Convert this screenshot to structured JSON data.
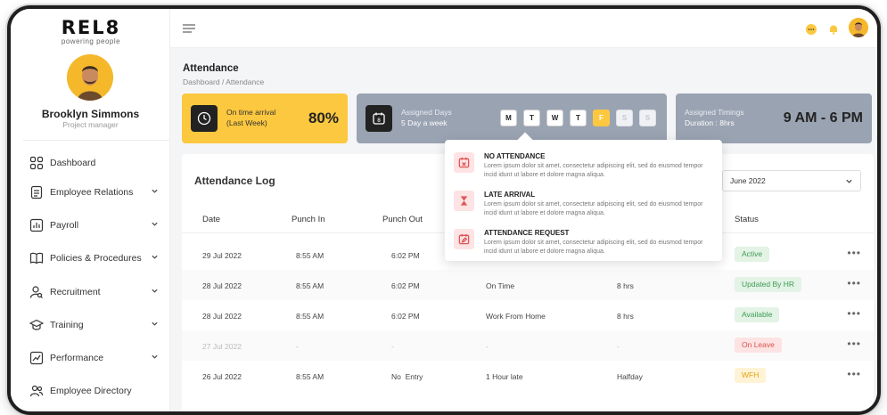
{
  "brand": {
    "name": "REL8",
    "tagline": "powering people"
  },
  "profile": {
    "name": "Brooklyn Simmons",
    "role": "Project manager"
  },
  "sidebar": {
    "items": [
      {
        "label": "Dashboard",
        "icon": "grid-icon",
        "has_chevron": false
      },
      {
        "label": "Employee Relations",
        "icon": "document-icon",
        "has_chevron": true
      },
      {
        "label": "Payroll",
        "icon": "chart-icon",
        "has_chevron": true
      },
      {
        "label": "Policies & Procedures",
        "icon": "book-icon",
        "has_chevron": true
      },
      {
        "label": "Recruitment",
        "icon": "user-search-icon",
        "has_chevron": true
      },
      {
        "label": "Training",
        "icon": "graduation-cap-icon",
        "has_chevron": true
      },
      {
        "label": "Performance",
        "icon": "trend-icon",
        "has_chevron": true
      },
      {
        "label": "Employee Directory",
        "icon": "users-icon",
        "has_chevron": false
      }
    ]
  },
  "page": {
    "title": "Attendance",
    "breadcrumb": "Dashboard / Attendance"
  },
  "cards": {
    "on_time": {
      "label_line1": "On time arrival",
      "label_line2": "(Last Week)",
      "value": "80%"
    },
    "assigned_days": {
      "label_line1": "Assigned Days",
      "label_line2": "5 Day a week",
      "days": [
        "M",
        "T",
        "W",
        "T",
        "F",
        "S",
        "S"
      ],
      "highlight_index": 4
    },
    "assigned_timings": {
      "label_line1": "Assigned Timings",
      "label_line2": "Duration : 8hrs",
      "value": "9 AM - 6 PM"
    }
  },
  "attendance_log": {
    "title": "Attendance Log",
    "month": "June 2022",
    "columns": [
      "Date",
      "Punch In",
      "Punch Out",
      "Status"
    ],
    "rows": [
      {
        "date": "29 Jul 2022",
        "punch_in": "8:55 AM",
        "punch_out": "6:02 PM",
        "remark": "",
        "hours": "",
        "status": "Active",
        "muted": false
      },
      {
        "date": "28 Jul 2022",
        "punch_in": "8:55 AM",
        "punch_out": "6:02 PM",
        "remark": "On Time",
        "hours": "8 hrs",
        "status": "Updated By HR",
        "muted": false
      },
      {
        "date": "28 Jul 2022",
        "punch_in": "8:55 AM",
        "punch_out": "6:02 PM",
        "remark": "Work From Home",
        "hours": "8 hrs",
        "status": "Available",
        "muted": false
      },
      {
        "date": "27 Jul 2022",
        "punch_in": "-",
        "punch_out": "-",
        "remark": "-",
        "hours": "-",
        "status": "On Leave",
        "muted": true
      },
      {
        "date": "26 Jul 2022",
        "punch_in": "8:55 AM",
        "punch_out": "No  Entry",
        "remark": "1 Hour late",
        "hours": "Halfday",
        "status": "WFH",
        "muted": false
      }
    ]
  },
  "popup": {
    "items": [
      {
        "title": "NO ATTENDANCE",
        "desc": "Lorem ipsum dolor sit amet, consectetur adipiscing elit, sed do eiusmod tempor incid idunt ut labore et dolore magna aliqua.",
        "icon": "calendar-x-icon"
      },
      {
        "title": "LATE ARRIVAL",
        "desc": "Lorem ipsum dolor sit amet, consectetur adipiscing elit, sed do eiusmod tempor incid idunt ut labore et dolore magna aliqua.",
        "icon": "hourglass-icon"
      },
      {
        "title": "ATTENDANCE REQUEST",
        "desc": "Lorem ipsum dolor sit amet, consectetur adipiscing elit, sed do eiusmod tempor incid idunt ut labore et dolore magna aliqua.",
        "icon": "calendar-edit-icon"
      }
    ]
  },
  "colors": {
    "accent_yellow": "#fcc83f",
    "card_gray": "#9aa3b2",
    "popup_icon_bg": "#fde3e3",
    "status_active_bg": "#e3f3e6",
    "status_active_fg": "#3f9b55",
    "status_leave_bg": "#fde3e3",
    "status_leave_fg": "#d9534f",
    "status_wfh_bg": "#fff3d6",
    "status_wfh_fg": "#e0a30e"
  }
}
